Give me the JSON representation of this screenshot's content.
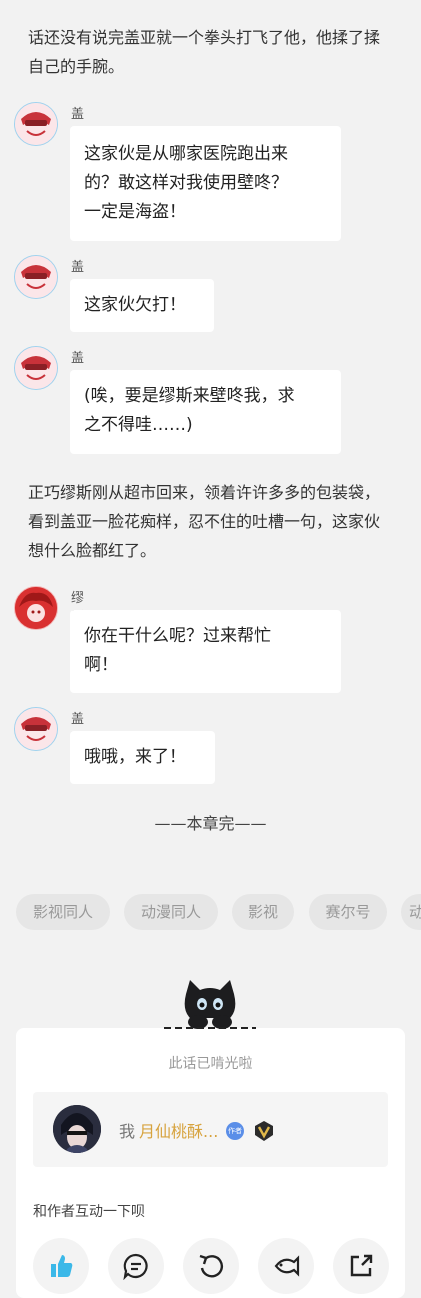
{
  "narration": [
    "话还没有说完盖亚就一个拳头打飞了他，他揉了揉自己的手腕。",
    "正巧缪斯刚从超市回来，领着许许多多的包装袋，看到盖亚一脸花痴样，忍不住的吐槽一句，这家伙想什么脸都红了。"
  ],
  "messages": [
    {
      "speaker": "盖亚",
      "lines": [
        "这家伙是从哪家医院跑出来",
        "的？敢这样对我使用壁咚？",
        "一定是海盗！"
      ]
    },
    {
      "speaker": "盖亚",
      "lines": [
        "这家伙欠打！"
      ]
    },
    {
      "speaker": "盖亚",
      "lines": [
        "(唉，要是缪斯来壁咚我，求",
        "之不得哇……)"
      ]
    },
    {
      "speaker": "缪斯",
      "lines": [
        "你在干什么呢？过来帮忙",
        "啊！"
      ]
    },
    {
      "speaker": "盖亚",
      "lines": [
        "哦哦，来了！"
      ]
    }
  ],
  "chapter_end": "——本章完——",
  "tags": [
    "影视同人",
    "动漫同人",
    "影视",
    "赛尔号",
    "动"
  ],
  "end_card": {
    "eaten_text": "此话已啃光啦",
    "author_prefix": "我",
    "author_name": "月仙桃酥...",
    "author_badge": "作者",
    "interact_title": "和作者互动一下呗"
  },
  "actions": [
    "like-icon",
    "comment-icon",
    "undo-icon",
    "fish-icon",
    "share-icon"
  ],
  "colors": {
    "background": "#f2f2f2",
    "bubble": "#ffffff",
    "author_name": "#d7a33e",
    "like": "#3bb8e8"
  }
}
